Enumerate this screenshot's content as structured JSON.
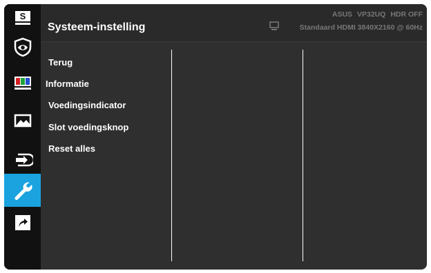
{
  "header": {
    "title": "Systeem-instelling",
    "model": [
      "ASUS",
      "VP32UQ",
      "HDR OFF"
    ],
    "signal": "Standaard HDMI 3840X2160 @ 60Hz"
  },
  "sidebar": {
    "items": [
      {
        "name": "splendid",
        "icon": "s-letter-icon",
        "label": "S"
      },
      {
        "name": "eye-care",
        "icon": "eye-icon"
      },
      {
        "name": "color",
        "icon": "color-bars-icon"
      },
      {
        "name": "image",
        "icon": "landscape-image-icon"
      },
      {
        "name": "input-select",
        "icon": "input-arrow-icon"
      },
      {
        "name": "system-setup",
        "icon": "wrench-icon",
        "active": true
      },
      {
        "name": "shortcut",
        "icon": "shortcut-arrow-icon"
      }
    ]
  },
  "menu": {
    "items": [
      "Terug",
      "Informatie",
      "Voedingsindicator",
      "Slot voedingsknop",
      "Reset alles"
    ]
  },
  "colors": {
    "accent": "#1aa3df",
    "background": "#2f2f2f",
    "sidebar": "#111111",
    "text": "#ffffff",
    "muted_text": "#777777"
  }
}
